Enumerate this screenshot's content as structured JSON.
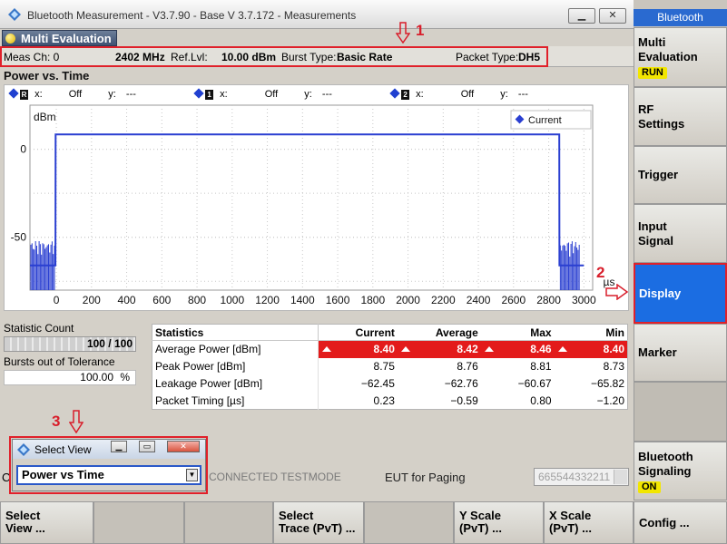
{
  "window": {
    "title": "Bluetooth Measurement  - V3.7.90 - Base V 3.7.172 - Measurements"
  },
  "tab": {
    "label": "Multi Evaluation"
  },
  "info": {
    "meas_ch": "Meas Ch: 0",
    "freq": "2402 MHz",
    "ref_lvl_label": "Ref.Lvl:",
    "ref_lvl": "10.00 dBm",
    "burst_label": "Burst Type:",
    "burst": "Basic Rate",
    "packet_label": "Packet Type:",
    "packet": "DH5"
  },
  "plot": {
    "title": "Power vs. Time",
    "markers": [
      {
        "id": "R",
        "x_label": "x:",
        "x": "Off",
        "y_label": "y:",
        "y": "---"
      },
      {
        "id": "1",
        "x_label": "x:",
        "x": "Off",
        "y_label": "y:",
        "y": "---"
      },
      {
        "id": "2",
        "x_label": "x:",
        "x": "Off",
        "y_label": "y:",
        "y": "---"
      }
    ]
  },
  "chart_data": {
    "type": "line",
    "ylabel": "dBm",
    "xunit": "µs",
    "x_ticks": [
      0,
      200,
      400,
      600,
      800,
      1000,
      1200,
      1400,
      1600,
      1800,
      2000,
      2200,
      2400,
      2600,
      2800,
      3000
    ],
    "y_ticks": [
      0,
      -50
    ],
    "xlim": [
      -150,
      3050
    ],
    "ylim": [
      -80,
      25
    ],
    "legend": "top-right",
    "series": [
      {
        "name": "Current",
        "color": "#2a3fd1",
        "x": [
          -150,
          -5,
          -4,
          2860,
          2861,
          3000
        ],
        "y": [
          -66,
          -66,
          8.4,
          8.4,
          -66,
          -66
        ]
      }
    ]
  },
  "stats": {
    "count_label": "Statistic Count",
    "count_value": "100 / 100",
    "tol_label": "Bursts out of Tolerance",
    "tol_value": "100.00",
    "tol_unit": "%",
    "headers": [
      "Statistics",
      "Current",
      "Average",
      "Max",
      "Min"
    ],
    "rows": [
      {
        "name": "Average Power [dBm]",
        "values": [
          "8.40",
          "8.42",
          "8.46",
          "8.40"
        ],
        "highlight": true
      },
      {
        "name": "Peak Power [dBm]",
        "values": [
          "8.75",
          "8.76",
          "8.81",
          "8.73"
        ],
        "highlight": false
      },
      {
        "name": "Leakage Power [dBm]",
        "values": [
          "−62.45",
          "−62.76",
          "−60.67",
          "−65.82"
        ],
        "highlight": false
      },
      {
        "name": "Packet Timing [µs]",
        "values": [
          "0.23",
          "−0.59",
          "0.80",
          "−1.20"
        ],
        "highlight": false
      }
    ]
  },
  "lower": {
    "mode": "CONNECTED TESTMODE",
    "mode_prefix": "C",
    "eut_label": "EUT for Paging",
    "eut_value": "665544332211"
  },
  "dialog": {
    "title": "Select View",
    "value": "Power vs Time"
  },
  "side": {
    "header": "Bluetooth",
    "keys": [
      {
        "l1": "Multi",
        "l2": "Evaluation",
        "badge": "RUN"
      },
      {
        "l1": "RF",
        "l2": "Settings",
        "badge": ""
      },
      {
        "l1": "Trigger",
        "l2": "",
        "badge": ""
      },
      {
        "l1": "Input",
        "l2": "Signal",
        "badge": ""
      },
      {
        "l1": "Display",
        "l2": "",
        "badge": ""
      },
      {
        "l1": "Marker",
        "l2": "",
        "badge": ""
      },
      {
        "l1": "Bluetooth",
        "l2": "Signaling",
        "badge": "ON"
      }
    ]
  },
  "bottom": {
    "keys": [
      {
        "l1": "Select",
        "l2": "View ..."
      },
      {
        "l1": "Select",
        "l2": "Trace (PvT) ..."
      },
      {
        "l1": "Y Scale",
        "l2": "(PvT) ..."
      },
      {
        "l1": "X Scale",
        "l2": "(PvT) ..."
      },
      {
        "l1": "Config ...",
        "l2": ""
      }
    ]
  },
  "annotations": [
    "1",
    "2",
    "3"
  ],
  "colors": {
    "highlight": "#e31b1b",
    "accent": "#1b6de2",
    "trace": "#2a3fd1",
    "annotation": "#d81e2b"
  }
}
